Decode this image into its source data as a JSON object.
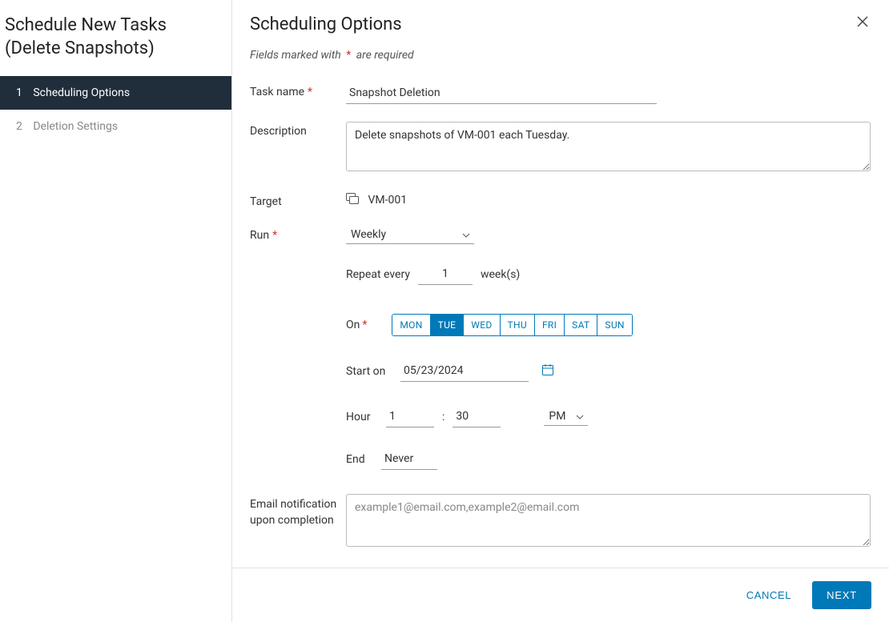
{
  "sidebar": {
    "title_line1": "Schedule New Tasks",
    "title_line2": "(Delete Snapshots)",
    "steps": [
      {
        "num": "1",
        "label": "Scheduling Options",
        "active": true
      },
      {
        "num": "2",
        "label": "Deletion Settings",
        "active": false
      }
    ]
  },
  "main": {
    "title": "Scheduling Options",
    "required_note_prefix": "Fields marked with",
    "required_note_suffix": "are required"
  },
  "form": {
    "task_name_label": "Task name",
    "task_name_value": "Snapshot Deletion",
    "description_label": "Description",
    "description_value": "Delete snapshots of VM-001 each Tuesday.",
    "target_label": "Target",
    "target_value": "VM-001",
    "run_label": "Run",
    "run_value": "Weekly",
    "repeat_label": "Repeat every",
    "repeat_value": "1",
    "repeat_unit": "week(s)",
    "on_label": "On",
    "days": [
      {
        "abbr": "MON",
        "selected": false
      },
      {
        "abbr": "TUE",
        "selected": true
      },
      {
        "abbr": "WED",
        "selected": false
      },
      {
        "abbr": "THU",
        "selected": false
      },
      {
        "abbr": "FRI",
        "selected": false
      },
      {
        "abbr": "SAT",
        "selected": false
      },
      {
        "abbr": "SUN",
        "selected": false
      }
    ],
    "start_on_label": "Start on",
    "start_on_value": "05/23/2024",
    "hour_label": "Hour",
    "hour_value": "1",
    "minute_value": "30",
    "ampm_value": "PM",
    "end_label": "End",
    "end_value": "Never",
    "email_label_line1": "Email notification",
    "email_label_line2": "upon completion",
    "email_placeholder": "example1@email.com,example2@email.com",
    "email_value": ""
  },
  "footer": {
    "cancel": "CANCEL",
    "next": "NEXT"
  }
}
